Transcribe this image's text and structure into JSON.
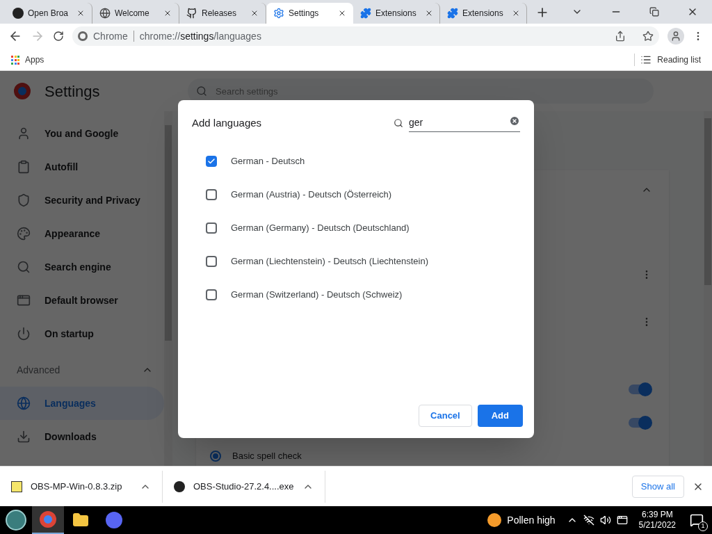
{
  "tabs": [
    {
      "label": "Open Broa",
      "selected": false
    },
    {
      "label": "Welcome",
      "selected": false
    },
    {
      "label": "Releases",
      "selected": false
    },
    {
      "label": "Settings",
      "selected": true
    },
    {
      "label": "Extensions",
      "selected": false
    },
    {
      "label": "Extensions",
      "selected": false
    }
  ],
  "omnibox": {
    "site": "Chrome",
    "url_prefix": "chrome://",
    "url_host": "settings",
    "url_path": "/languages"
  },
  "bookmarks": {
    "apps": "Apps",
    "reading_list": "Reading list"
  },
  "settings": {
    "title": "Settings",
    "search_placeholder": "Search settings",
    "nav": [
      {
        "label": "You and Google",
        "selected": false
      },
      {
        "label": "Autofill",
        "selected": false
      },
      {
        "label": "Security and Privacy",
        "selected": false
      },
      {
        "label": "Appearance",
        "selected": false
      },
      {
        "label": "Search engine",
        "selected": false
      },
      {
        "label": "Default browser",
        "selected": false
      },
      {
        "label": "On startup",
        "selected": false
      }
    ],
    "advanced": {
      "label": "Advanced",
      "expanded": true
    },
    "advanced_nav": [
      {
        "label": "Languages",
        "selected": true
      },
      {
        "label": "Downloads",
        "selected": false
      }
    ],
    "toggles": [
      {
        "on": true
      },
      {
        "on": true
      }
    ],
    "spell_check": {
      "label": "Basic spell check",
      "selected": true
    }
  },
  "dialog": {
    "title": "Add languages",
    "search_value": "ger",
    "languages": [
      {
        "label": "German - Deutsch",
        "checked": true
      },
      {
        "label": "German (Austria) - Deutsch (Österreich)",
        "checked": false
      },
      {
        "label": "German (Germany) - Deutsch (Deutschland)",
        "checked": false
      },
      {
        "label": "German (Liechtenstein) - Deutsch (Liechtenstein)",
        "checked": false
      },
      {
        "label": "German (Switzerland) - Deutsch (Schweiz)",
        "checked": false
      }
    ],
    "cancel": "Cancel",
    "add": "Add"
  },
  "downloads": {
    "items": [
      {
        "name": "OBS-MP-Win-0.8.3.zip"
      },
      {
        "name": "OBS-Studio-27.2.4....exe"
      }
    ],
    "show_all": "Show all"
  },
  "taskbar": {
    "weather": "Pollen high",
    "time": "6:39 PM",
    "date": "5/21/2022",
    "notifications": "1"
  }
}
